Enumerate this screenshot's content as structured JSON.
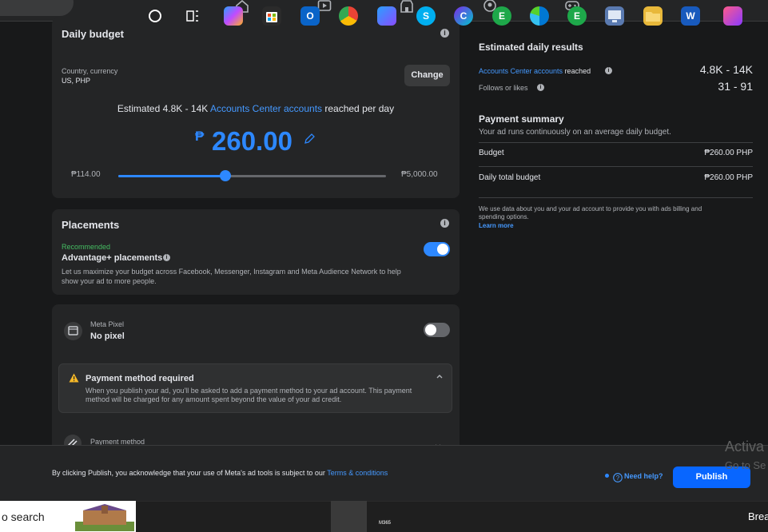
{
  "topnav": {
    "icons": [
      "home-icon",
      "video-icon",
      "marketplace-icon",
      "groups-icon",
      "gaming-icon"
    ]
  },
  "daily_budget": {
    "title": "Daily budget",
    "country_label": "Country, currency",
    "country_value": "US, PHP",
    "change_label": "Change",
    "estimate_prefix": "Estimated 4.8K - 14K ",
    "estimate_link": "Accounts Center accounts",
    "estimate_suffix": " reached per day",
    "currency_symbol": "₱",
    "amount": "260.00",
    "slider_min": "₱114.00",
    "slider_max": "₱5,000.00",
    "slider_fraction": 0.4
  },
  "placements": {
    "title": "Placements",
    "recommended": "Recommended",
    "advantage_label": "Advantage+ placements",
    "description": "Let us maximize your budget across Facebook, Messenger, Instagram and Meta Audience Network to help show your ad to more people.",
    "enabled": true
  },
  "pixel": {
    "label": "Meta Pixel",
    "value": "No pixel",
    "enabled": false
  },
  "payment_warning": {
    "title": "Payment method required",
    "text": "When you publish your ad, you'll be asked to add a payment method to your ad account. This payment method will be charged for any amount spent beyond the value of your ad credit."
  },
  "payment_method": {
    "label": "Payment method"
  },
  "estimated_results": {
    "title": "Estimated daily results",
    "reach_link": "Accounts Center accounts",
    "reach_suffix": " reached",
    "reach_value": "4.8K - 14K",
    "follows_label": "Follows or likes",
    "follows_value": "31 - 91"
  },
  "payment_summary": {
    "title": "Payment summary",
    "subtitle": "Your ad runs continuously on an average daily budget.",
    "budget_label": "Budget",
    "budget_value": "₱260.00 PHP",
    "daily_total_label": "Daily total budget",
    "daily_total_value": "₱260.00 PHP",
    "disclaimer": "We use data about you and your ad account to provide you with ads billing and spending options.",
    "learn_more": "Learn more"
  },
  "footer": {
    "consent_text": "By clicking Publish, you acknowledge that your use of Meta's ad tools is subject to our ",
    "terms_link": "Terms & conditions",
    "need_help": "Need help?",
    "publish": "Publish"
  },
  "watermark": {
    "line1": "Activa",
    "line2": "Go to Se"
  },
  "taskbar": {
    "search_text": "o search",
    "m365_label": "M365",
    "last_app_label": "Brea"
  },
  "colors": {
    "accent": "#0866ff",
    "link": "#4599ff",
    "toggle_on": "#2d88ff",
    "warning": "#f7b928",
    "recommended": "#45bd62"
  }
}
